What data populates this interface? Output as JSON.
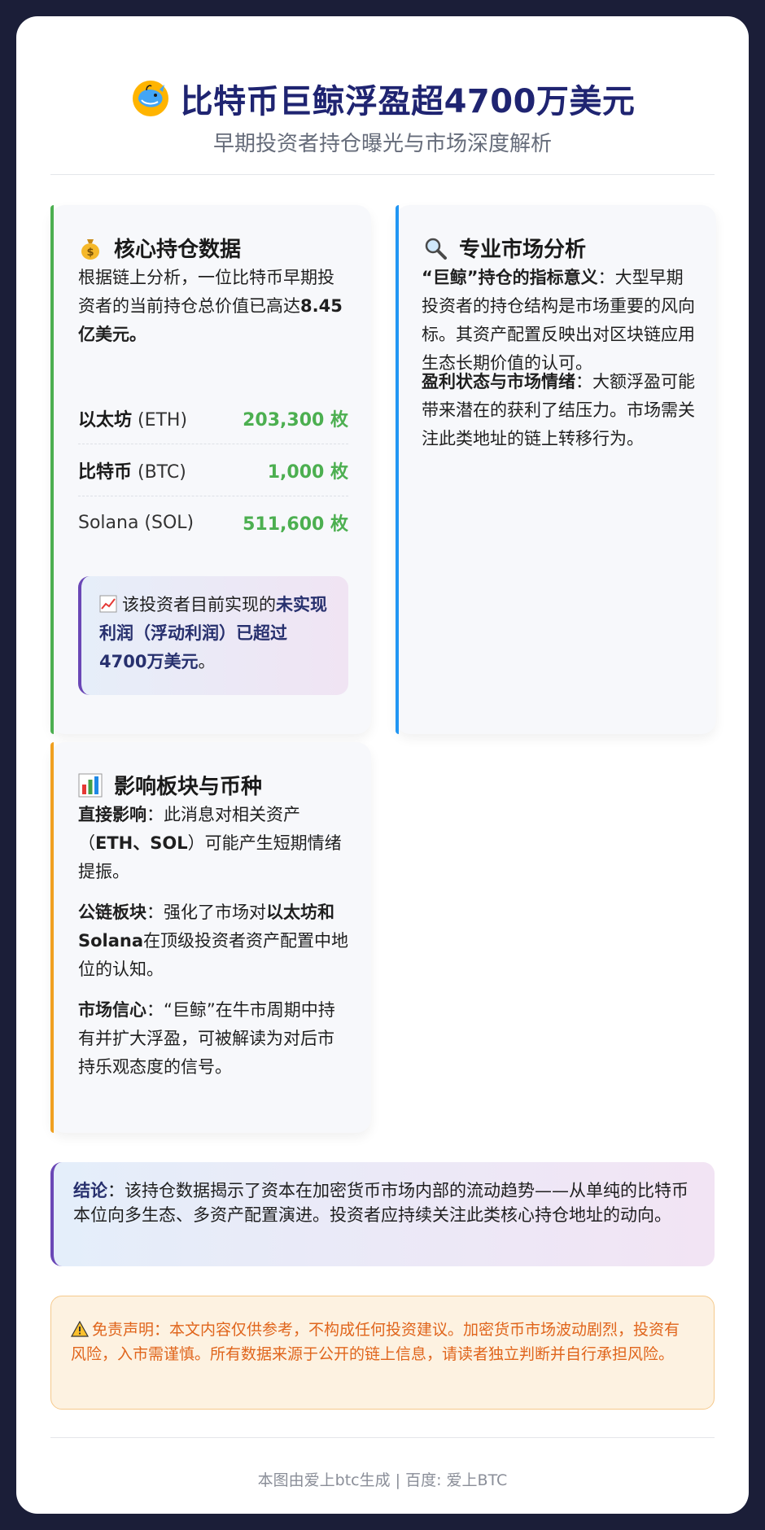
{
  "header": {
    "title": "比特币巨鲸浮盈超4700万美元",
    "subtitle": "早期投资者持仓曝光与市场深度解析"
  },
  "holdings_panel": {
    "title": "核心持仓数据",
    "intro_prefix": "根据链上分析，一位比特币早期投资者的当前持仓总价值已高达",
    "intro_value": "8.45亿美元。",
    "rows": [
      {
        "name_bold": "以太坊",
        "name_rest": " (ETH)",
        "value": "203,300 枚"
      },
      {
        "name_bold": "比特币",
        "name_rest": " (BTC)",
        "value": "1,000 枚"
      },
      {
        "name_bold": "",
        "name_rest": "Solana (SOL)",
        "value": "511,600 枚"
      }
    ],
    "profit_prefix": "该投资者目前实现的",
    "profit_highlight": "未实现利润（浮动利润）已超过4700万美元",
    "profit_suffix": "。"
  },
  "analysis_panel": {
    "title": "专业市场分析",
    "p1_lead": "“巨鲸”持仓的指标意义",
    "p1_text": "：大型早期投资者的持仓结构是市场重要的风向标。其资产配置反映出对区块链应用生态长期价值的认可。",
    "p2_lead": "盈利状态与市场情绪",
    "p2_text": "：大额浮盈可能带来潜在的获利了结压力。市场需关注此类地址的链上转移行为。"
  },
  "impact_panel": {
    "title": "影响板块与币种",
    "p1_lead": "直接影响",
    "p1_a": "：此消息对相关资产（",
    "p1_bold": "ETH、SOL",
    "p1_b": "）可能产生短期情绪提振。",
    "p2_lead": "公链板块",
    "p2_a": "：强化了市场对",
    "p2_bold": "以太坊和Solana",
    "p2_b": "在顶级投资者资产配置中地位的认知。",
    "p3_lead": "市场信心",
    "p3_text": "：“巨鲸”在牛市周期中持有并扩大浮盈，可被解读为对后市持乐观态度的信号。"
  },
  "conclusion": {
    "lead": "结论",
    "text": "：该持仓数据揭示了资本在加密货币市场内部的流动趋势——从单纯的比特币本位向多生态、多资产配置演进。投资者应持续关注此类核心持仓地址的动向。"
  },
  "disclaimer": {
    "text": "免责声明：本文内容仅供参考，不构成任何投资建议。加密货币市场波动剧烈，投资有风险，入市需谨慎。所有数据来源于公开的链上信息，请读者独立判断并自行承担风险。"
  },
  "footer": {
    "text": "本图由爱上btc生成 | 百度: 爱上BTC"
  },
  "colors": {
    "title": "#1f2471",
    "holdings_accent": "#4caf50",
    "analysis_accent": "#2196f3",
    "impact_accent": "#f0a020",
    "purple_accent": "#6a47b6",
    "disclaimer_text": "#e0651c",
    "page_bg": "#1b1e38"
  },
  "icons": {
    "title": "whale-icon",
    "holdings": "money-bag-icon",
    "analysis": "magnifier-icon",
    "profit": "chart-up-icon",
    "impact": "bar-chart-icon",
    "disclaimer": "warning-icon"
  }
}
